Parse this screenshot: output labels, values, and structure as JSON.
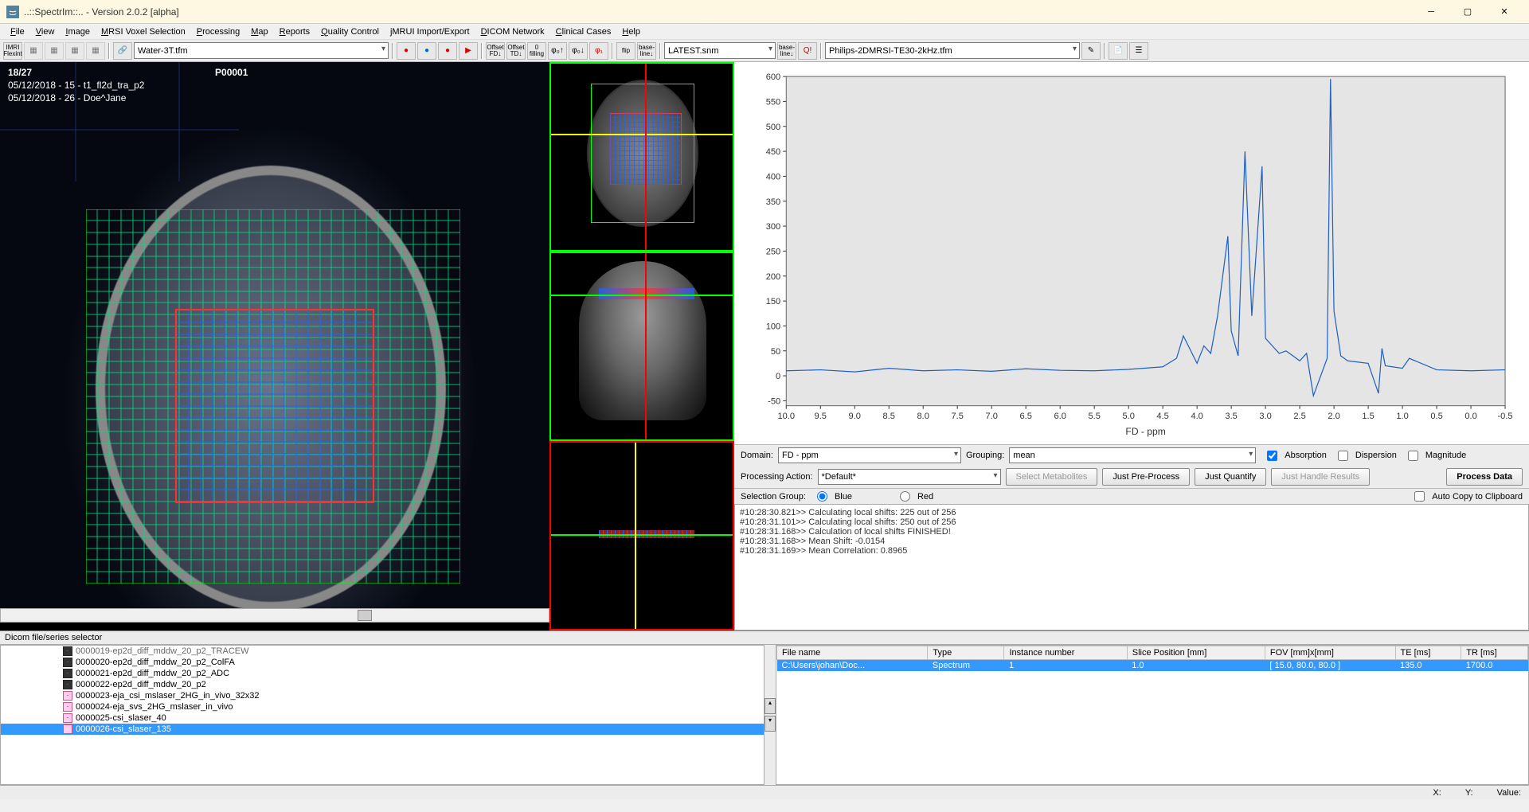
{
  "app": {
    "title": "..::SpectrIm::..   -   Version 2.0.2 [alpha]"
  },
  "menus": [
    "File",
    "View",
    "Image",
    "MRSI Voxel Selection",
    "Processing",
    "Map",
    "Reports",
    "Quality Control",
    "jMRUI Import/Export",
    "DICOM Network",
    "Clinical Cases",
    "Help"
  ],
  "toolbar": {
    "combo1": "Water-3T.tfm",
    "combo2": "LATEST.snm",
    "combo3": "Philips-2DMRSI-TE30-2kHz.tfm"
  },
  "mri": {
    "counter": "18/27",
    "line1": "05/12/2018 - 15 - t1_fl2d_tra_p2",
    "line2": "05/12/2018 - 26 - Doe^Jane",
    "patient": "P00001"
  },
  "controls": {
    "domain_label": "Domain:",
    "domain_value": "FD - ppm",
    "grouping_label": "Grouping:",
    "grouping_value": "mean",
    "absorption": "Absorption",
    "dispersion": "Dispersion",
    "magnitude": "Magnitude",
    "procaction_label": "Processing Action:",
    "procaction_value": "*Default*",
    "btn_metab": "Select Metabolites",
    "btn_preprocess": "Just Pre-Process",
    "btn_quantify": "Just Quantify",
    "btn_handle": "Just Handle Results",
    "btn_process": "Process Data",
    "selgroup_label": "Selection Group:",
    "radio_blue": "Blue",
    "radio_red": "Red",
    "autocopy": "Auto Copy to Clipboard"
  },
  "log": [
    "#10:28:30.821>> Calculating local shifts: 225 out of 256",
    "#10:28:31.101>> Calculating local shifts: 250 out of 256",
    "#10:28:31.168>> Calculation of local shifts FINISHED!",
    "#10:28:31.168>> Mean Shift: -0.0154",
    "#10:28:31.169>> Mean Correlation: 0.8965"
  ],
  "bottom": {
    "title": "Dicom file/series selector",
    "tree": [
      {
        "icon": "dk",
        "label": "0000019-ep2d_diff_mddw_20_p2_TRACEW",
        "sel": false,
        "cut": true
      },
      {
        "icon": "dk",
        "label": "0000020-ep2d_diff_mddw_20_p2_ColFA",
        "sel": false
      },
      {
        "icon": "dk",
        "label": "0000021-ep2d_diff_mddw_20_p2_ADC",
        "sel": false
      },
      {
        "icon": "dk",
        "label": "0000022-ep2d_diff_mddw_20_p2",
        "sel": false
      },
      {
        "icon": "lt",
        "label": "0000023-eja_csi_mslaser_2HG_in_vivo_32x32",
        "sel": false
      },
      {
        "icon": "lt",
        "label": "0000024-eja_svs_2HG_mslaser_in_vivo",
        "sel": false
      },
      {
        "icon": "lt",
        "label": "0000025-csi_slaser_40",
        "sel": false
      },
      {
        "icon": "lt",
        "label": "0000026-csi_slaser_135",
        "sel": true
      }
    ],
    "table": {
      "headers": [
        "File name",
        "Type",
        "Instance number",
        "Slice Position [mm]",
        "FOV [mm]x[mm]",
        "TE [ms]",
        "TR [ms]"
      ],
      "row": [
        "C:\\Users\\johan\\Doc...",
        "Spectrum",
        "1",
        "1.0",
        "[ 15.0, 80.0, 80.0 ]",
        "135.0",
        "1700.0"
      ]
    }
  },
  "status": {
    "x": "X:",
    "y": "Y:",
    "value": "Value:"
  },
  "chart_data": {
    "type": "line",
    "title": "",
    "xlabel": "FD - ppm",
    "ylabel": "",
    "xlim": [
      10.0,
      -0.5
    ],
    "ylim": [
      -60,
      600
    ],
    "xticks": [
      10.0,
      9.5,
      9.0,
      8.5,
      8.0,
      7.5,
      7.0,
      6.5,
      6.0,
      5.5,
      5.0,
      4.5,
      4.0,
      3.5,
      3.0,
      2.5,
      2.0,
      1.5,
      1.0,
      0.5,
      0.0,
      -0.5
    ],
    "yticks": [
      -50,
      0,
      50,
      100,
      150,
      200,
      250,
      300,
      350,
      400,
      450,
      500,
      550,
      600
    ],
    "series": [
      {
        "name": "spectrum",
        "x": [
          10.0,
          9.5,
          9.0,
          8.5,
          8.0,
          7.5,
          7.0,
          6.5,
          6.0,
          5.5,
          5.0,
          4.5,
          4.3,
          4.2,
          4.0,
          3.9,
          3.8,
          3.7,
          3.55,
          3.5,
          3.4,
          3.3,
          3.2,
          3.05,
          3.0,
          2.9,
          2.8,
          2.7,
          2.6,
          2.5,
          2.4,
          2.3,
          2.1,
          2.05,
          2.0,
          1.9,
          1.8,
          1.5,
          1.35,
          1.3,
          1.25,
          1.0,
          0.9,
          0.5,
          0.0,
          -0.5
        ],
        "y": [
          10,
          12,
          8,
          15,
          10,
          12,
          9,
          14,
          11,
          10,
          13,
          18,
          35,
          80,
          25,
          60,
          45,
          120,
          280,
          90,
          40,
          450,
          120,
          420,
          75,
          60,
          45,
          50,
          40,
          30,
          45,
          -40,
          35,
          595,
          130,
          40,
          30,
          25,
          -35,
          55,
          20,
          15,
          35,
          12,
          10,
          12
        ]
      }
    ]
  }
}
